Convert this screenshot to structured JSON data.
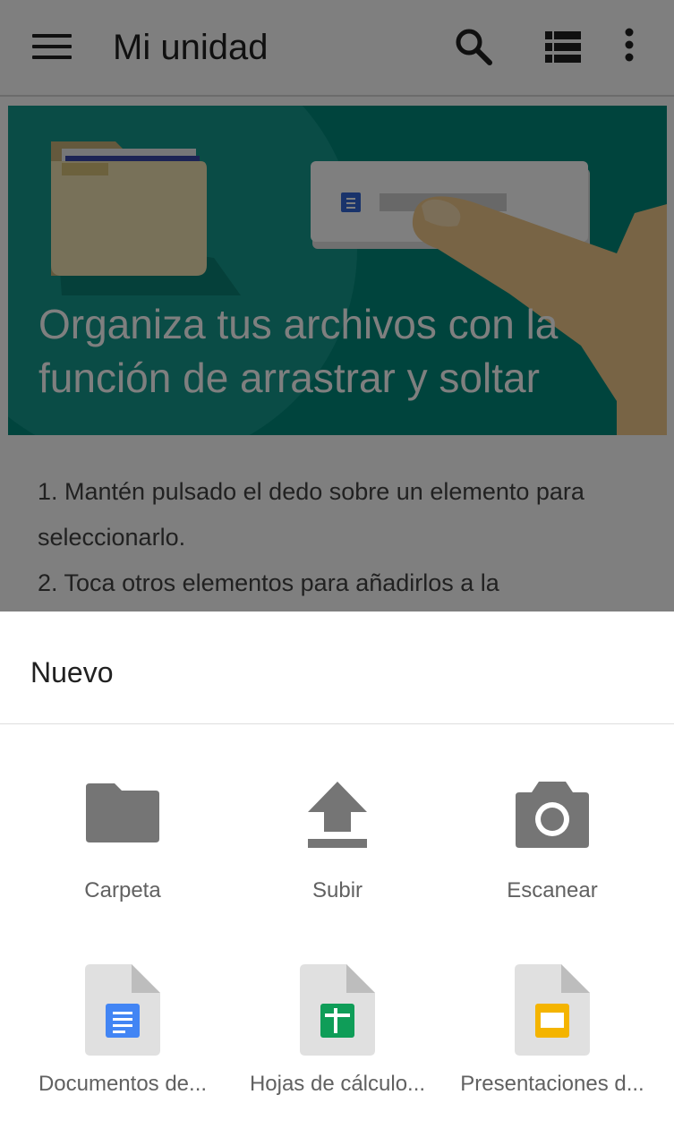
{
  "appbar": {
    "title": "Mi unidad",
    "menu_icon": "hamburger-menu-icon",
    "search_icon": "search-icon",
    "view_icon": "list-view-icon",
    "more_icon": "more-vert-icon"
  },
  "banner": {
    "title": "Organiza tus archivos con la función de arrastrar y soltar",
    "bg_color": "#00897b"
  },
  "card": {
    "line1": "1. Mantén pulsado el dedo sobre un elemento para seleccionarlo.",
    "line2": "2. Toca otros elementos para añadirlos a la"
  },
  "sheet": {
    "title": "Nuevo",
    "items": [
      {
        "label": "Carpeta",
        "icon": "folder-icon"
      },
      {
        "label": "Subir",
        "icon": "upload-icon"
      },
      {
        "label": "Escanear",
        "icon": "camera-icon"
      },
      {
        "label": "Documentos de...",
        "icon": "google-docs-icon",
        "color": "#4285f4"
      },
      {
        "label": "Hojas de cálculo...",
        "icon": "google-sheets-icon",
        "color": "#0f9d58"
      },
      {
        "label": "Presentaciones d...",
        "icon": "google-slides-icon",
        "color": "#f4b400"
      }
    ]
  }
}
